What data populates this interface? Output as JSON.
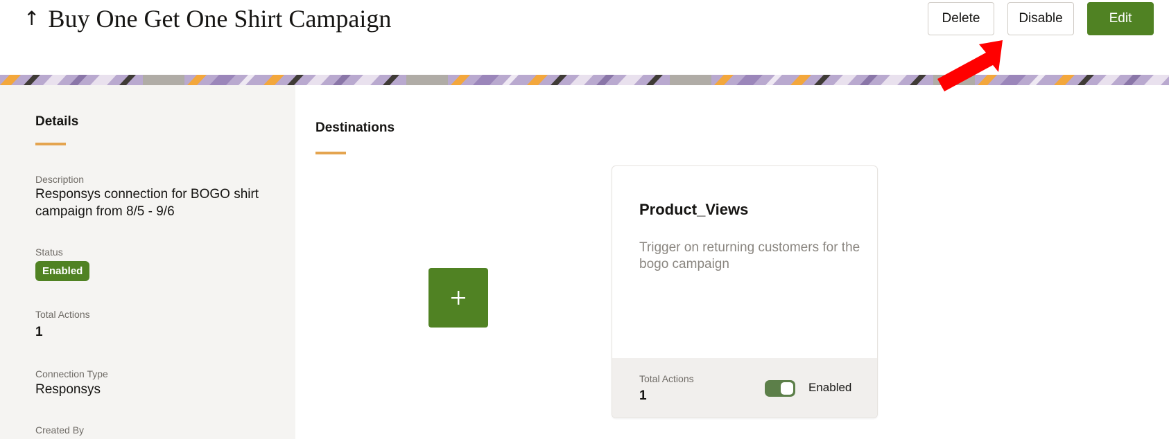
{
  "header": {
    "back_icon": "up-arrow-icon",
    "back_glyph": "↑",
    "title": "Buy One Get One Shirt Campaign",
    "buttons": {
      "delete": "Delete",
      "disable": "Disable",
      "edit": "Edit"
    }
  },
  "colors": {
    "primary": "#508223",
    "accent_underline": "#e4a44f",
    "side_panel_bg": "#f5f4f2",
    "annotation_arrow": "#ff0000"
  },
  "details": {
    "heading": "Details",
    "description_label": "Description",
    "description_value": "Responsys connection for BOGO shirt campaign from 8/5 - 9/6",
    "status_label": "Status",
    "status_value": "Enabled",
    "total_actions_label": "Total Actions",
    "total_actions_value": "1",
    "connection_type_label": "Connection Type",
    "connection_type_value": "Responsys",
    "created_by_label": "Created By"
  },
  "destinations": {
    "heading": "Destinations",
    "add_icon": "plus-icon",
    "cards": [
      {
        "name": "Product_Views",
        "description": "Trigger on returning customers for the bogo campaign",
        "total_actions_label": "Total Actions",
        "total_actions_value": "1",
        "toggle_state": "on",
        "toggle_label": "Enabled"
      }
    ]
  }
}
